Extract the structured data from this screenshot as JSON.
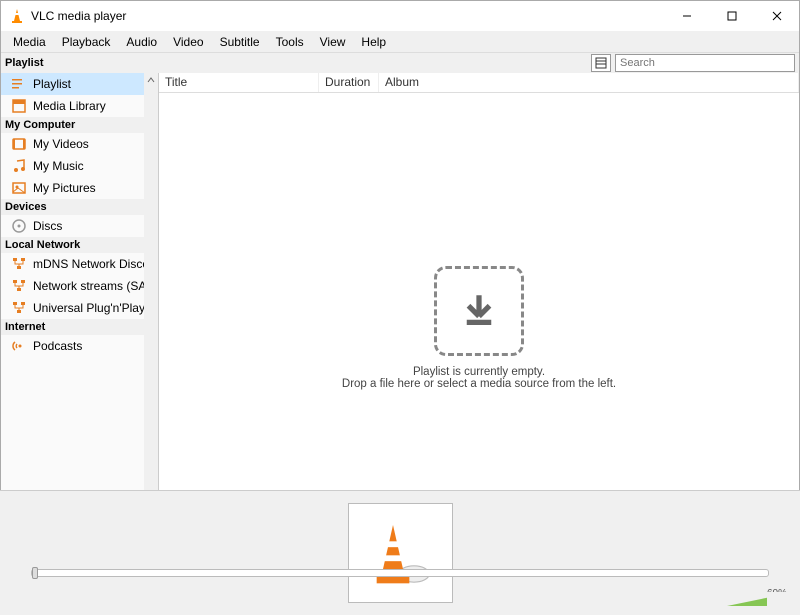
{
  "window": {
    "title": "VLC media player"
  },
  "menu": {
    "items": [
      "Media",
      "Playback",
      "Audio",
      "Video",
      "Subtitle",
      "Tools",
      "View",
      "Help"
    ]
  },
  "toolstrip": {
    "label": "Playlist",
    "search_placeholder": "Search"
  },
  "sidebar": {
    "sections": [
      {
        "title": "",
        "items": [
          {
            "icon": "playlist",
            "label": "Playlist",
            "selected": true
          },
          {
            "icon": "library",
            "label": "Media Library"
          }
        ]
      },
      {
        "title": "My Computer",
        "items": [
          {
            "icon": "video",
            "label": "My Videos"
          },
          {
            "icon": "music",
            "label": "My Music"
          },
          {
            "icon": "picture",
            "label": "My Pictures"
          }
        ]
      },
      {
        "title": "Devices",
        "items": [
          {
            "icon": "disc",
            "label": "Discs"
          }
        ]
      },
      {
        "title": "Local Network",
        "items": [
          {
            "icon": "network",
            "label": "mDNS Network Disco..."
          },
          {
            "icon": "network",
            "label": "Network streams (SAP)"
          },
          {
            "icon": "network",
            "label": "Universal Plug'n'Play"
          }
        ]
      },
      {
        "title": "Internet",
        "items": [
          {
            "icon": "podcast",
            "label": "Podcasts"
          }
        ]
      }
    ]
  },
  "columns": {
    "title": "Title",
    "duration": "Duration",
    "album": "Album"
  },
  "empty": {
    "line1": "Playlist is currently empty.",
    "line2": "Drop a file here or select a media source from the left."
  },
  "seek": {
    "left": "--:--",
    "right": "--:--"
  },
  "volume": {
    "percent": "60%"
  }
}
